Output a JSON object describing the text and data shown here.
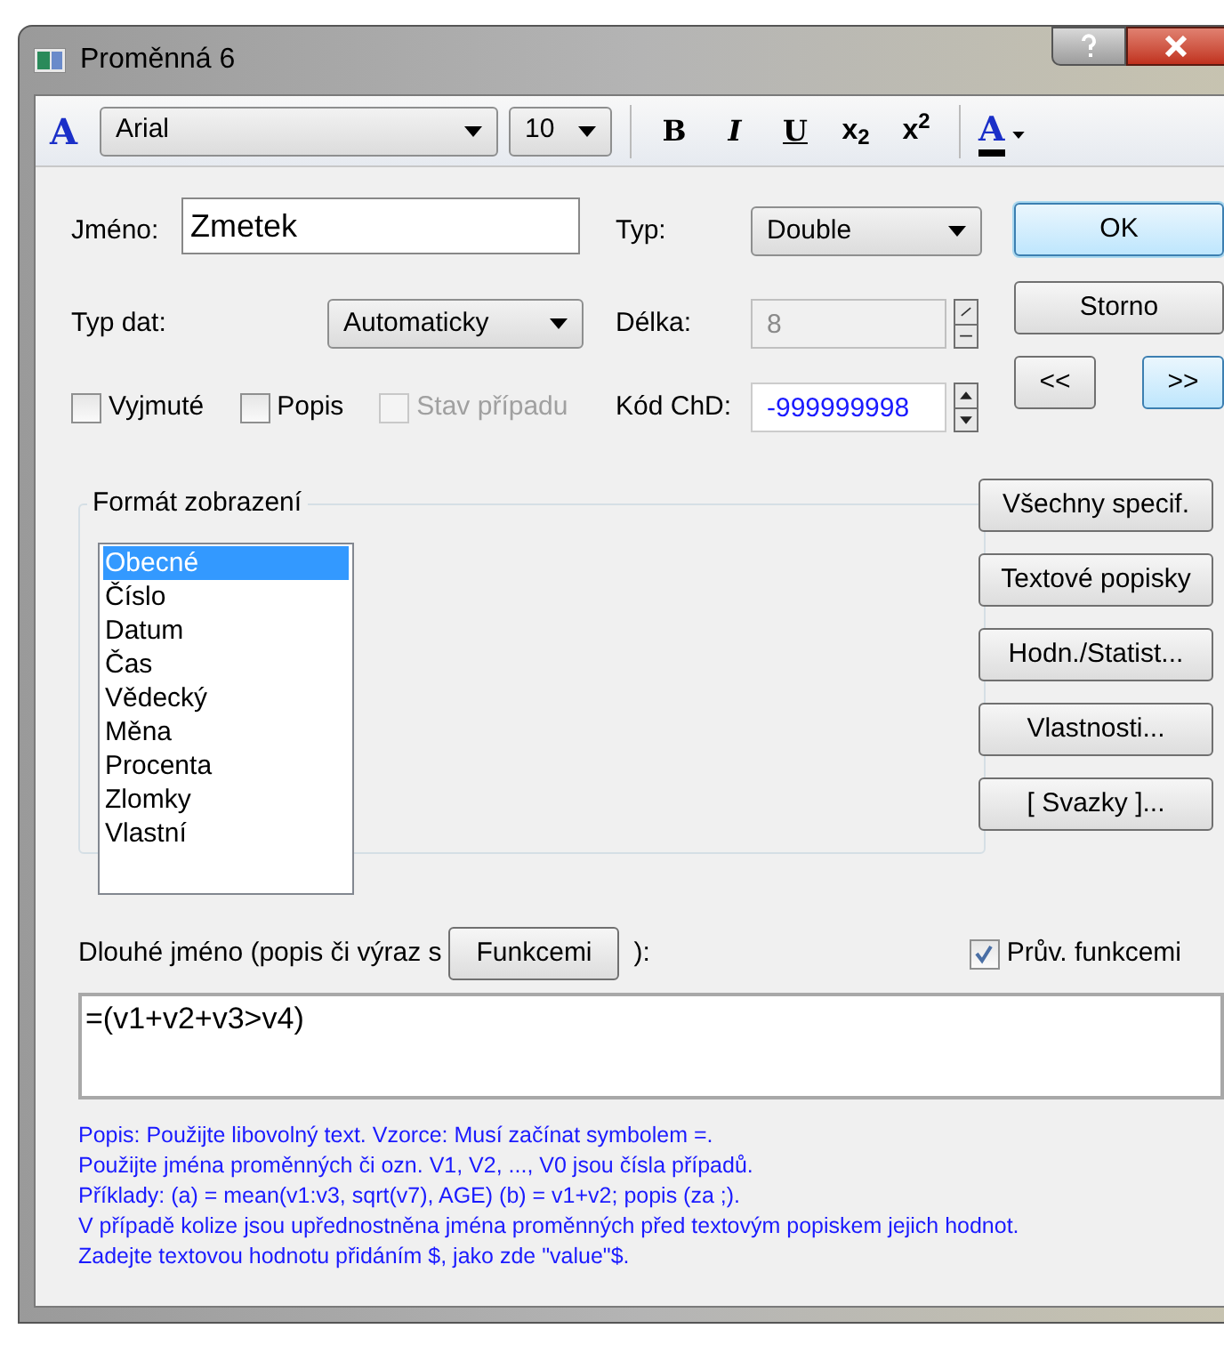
{
  "window": {
    "title": "Proměnná 6"
  },
  "toolbar": {
    "font_icon": "A",
    "font": "Arial",
    "size": "10",
    "format_buttons": [
      {
        "label": "B",
        "kind": "bold"
      },
      {
        "label": "I",
        "kind": "italic"
      },
      {
        "label": "U",
        "kind": "underline"
      },
      {
        "label": "x$_{2}$",
        "kind": "sub"
      },
      {
        "label": "x$^{2}$",
        "kind": "sup"
      }
    ],
    "color_button": "A"
  },
  "name": {
    "label": "Jméno:",
    "value": "Zmetek"
  },
  "type": {
    "label": "Typ:",
    "value": "Double"
  },
  "data_type": {
    "label": "Typ dat:",
    "value": "Automaticky"
  },
  "length": {
    "label": "Délka:",
    "value": "8",
    "disabled": true
  },
  "checkboxes": [
    {
      "label": "Vyjmuté",
      "checked": false,
      "disabled": false
    },
    {
      "label": "Popis",
      "checked": false,
      "disabled": false
    },
    {
      "label": "Stav případu",
      "checked": false,
      "disabled": true
    }
  ],
  "missing_code": {
    "label": "Kód ChD:",
    "value": "-999999998"
  },
  "dialog_buttons": [
    {
      "label": "OK",
      "default": true
    },
    {
      "label": "Storno",
      "default": false
    }
  ],
  "nav_buttons": [
    {
      "label": "<<",
      "selected": false
    },
    {
      "label": ">>",
      "selected": true
    }
  ],
  "format_group": {
    "title": "Formát zobrazení",
    "items": [
      {
        "label": "Obecné",
        "selected": true
      },
      {
        "label": "Číslo",
        "selected": false
      },
      {
        "label": "Datum",
        "selected": false
      },
      {
        "label": "Čas",
        "selected": false
      },
      {
        "label": "Vědecký",
        "selected": false
      },
      {
        "label": "Měna",
        "selected": false
      },
      {
        "label": "Procenta",
        "selected": false
      },
      {
        "label": "Zlomky",
        "selected": false
      },
      {
        "label": "Vlastní",
        "selected": false
      }
    ]
  },
  "side_buttons": [
    "Všechny specif.",
    "Textové popisky",
    "Hodn./Statist...",
    "Vlastnosti...",
    "[ Svazky ]..."
  ],
  "long_name": {
    "label_before": "Dlouhé jméno (popis či výraz s",
    "button": "Funkcemi",
    "label_after": "):",
    "checkbox": {
      "label": "Prův. funkcemi",
      "checked": true
    },
    "value": "=(v1+v2+v3>v4)"
  },
  "help_lines": [
    "Popis: Použijte libovolný text. Vzorce: Musí začínat symbolem =.",
    "Použijte jména proměnných či ozn. V1, V2, ..., V0 jsou čísla případů.",
    "Příklady: (a) = mean(v1:v3, sqrt(v7), AGE) (b) = v1+v2; popis (za ;).",
    "V případě kolize jsou upřednostněna jména proměnných před textovým popiskem jejich hodnot.",
    "Zadejte textovou hodnotu přidáním $, jako zde \"value\"$."
  ]
}
